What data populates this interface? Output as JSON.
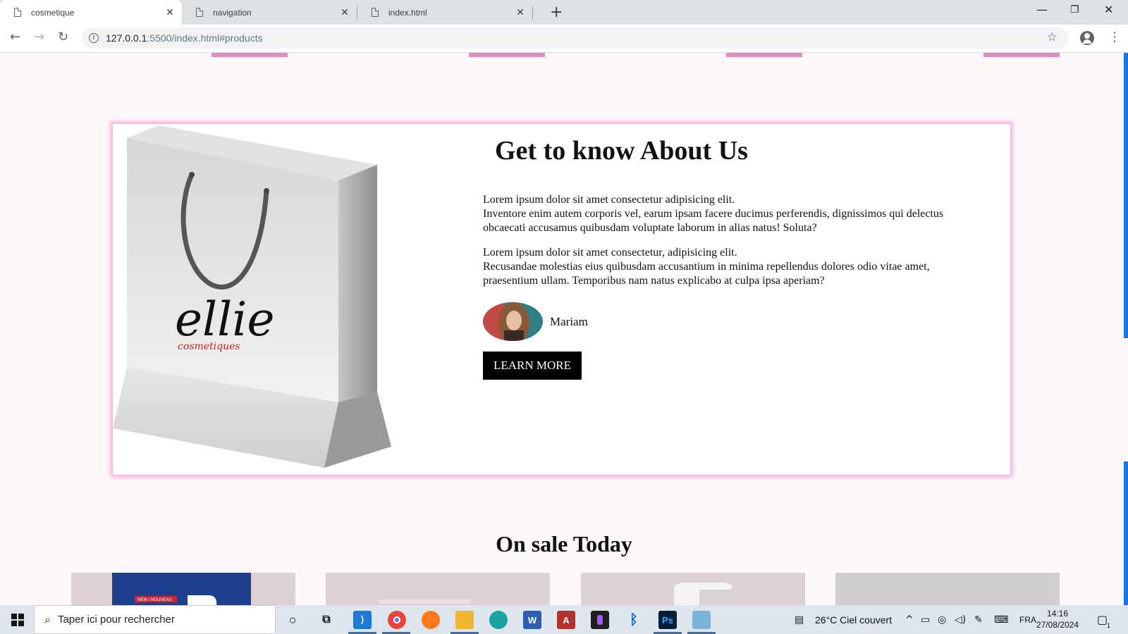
{
  "browser": {
    "tabs": [
      {
        "label": "cosmetique",
        "active": true
      },
      {
        "label": "navigation",
        "active": false
      },
      {
        "label": "index.html",
        "active": false
      }
    ],
    "url_host": "127.0.0.1",
    "url_path": ":5500/index.html#products"
  },
  "about": {
    "title": "Get to know About Us",
    "paragraph1_line1": "Lorem ipsum dolor sit amet consectetur adipisicing elit.",
    "paragraph1_line2": "Inventore enim autem corporis vel, earum ipsam facere ducimus perferendis, dignissimos qui delectus obcaecati accusamus quibusdam voluptate laborum in alias natus! Soluta?",
    "paragraph2_line1": "Lorem ipsum dolor sit amet consectetur, adipisicing elit.",
    "paragraph2_line2": "Recusandae molestias eius quibusdam accusantium in minima repellendus dolores odio vitae amet, praesentium ullam. Temporibus nam natus explicabo at culpa ipsa aperiam?",
    "author_name": "Mariam",
    "button_label": "LEARN MORE",
    "bag_brand": "ellie",
    "bag_subbrand": "cosmetiques"
  },
  "sale": {
    "title": "On sale Today",
    "product_badge": "NEW / NOUVEAU"
  },
  "taskbar": {
    "search_placeholder": "Taper ici pour rechercher",
    "weather": "26°C  Ciel couvert",
    "language": "FRA",
    "time": "14:16",
    "date": "27/08/2024",
    "notification_count": "1"
  },
  "colors": {
    "accent_pink": "#e38cbf",
    "card_glow": "#ff9fd4",
    "button_bg": "#000000"
  }
}
